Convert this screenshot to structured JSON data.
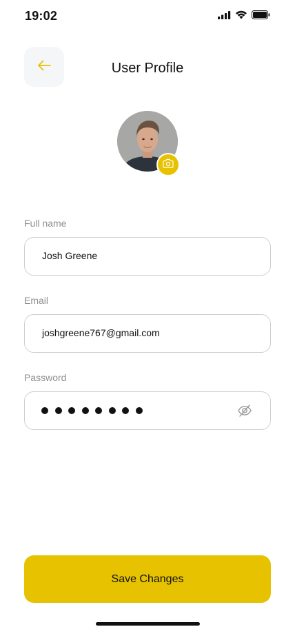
{
  "status_bar": {
    "time": "19:02",
    "icons": [
      "signal-icon",
      "wifi-icon",
      "battery-icon"
    ]
  },
  "header": {
    "back_icon": "arrow-left-icon",
    "title": "User Profile"
  },
  "profile": {
    "avatar": "avatar",
    "camera_icon": "camera-icon"
  },
  "form": {
    "full_name": {
      "label": "Full name",
      "value": "Josh Greene"
    },
    "email": {
      "label": "Email",
      "value": "joshgreene767@gmail.com"
    },
    "password": {
      "label": "Password",
      "masked_length": 8,
      "toggle_icon": "eye-off-icon"
    }
  },
  "actions": {
    "save_label": "Save Changes"
  },
  "colors": {
    "accent": "#E6C200",
    "field_border": "#CFCFCF",
    "label": "#8F8F8F",
    "back_button_bg": "#F5F6F7"
  }
}
